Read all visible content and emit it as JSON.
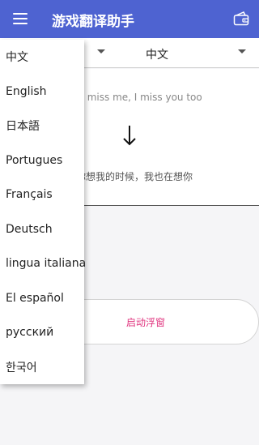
{
  "app_bar": {
    "title": "游戏翻译助手",
    "color": "#4e63d1",
    "menu_icon": "hamburger-icon",
    "right_icon": "wallet-icon"
  },
  "lang_selector": {
    "target_language": "中文"
  },
  "translation": {
    "source_text": "If you miss me, I miss you too",
    "result_text": "当你想我的时候，我也在想你"
  },
  "float_button": {
    "label": "启动浮窗",
    "color": "#e0357f"
  },
  "language_menu": {
    "items": [
      "中文",
      "English",
      "日本語",
      "Portugues",
      "Français",
      "Deutsch",
      "lingua italiana",
      "El español",
      "русский",
      "한국어"
    ]
  }
}
